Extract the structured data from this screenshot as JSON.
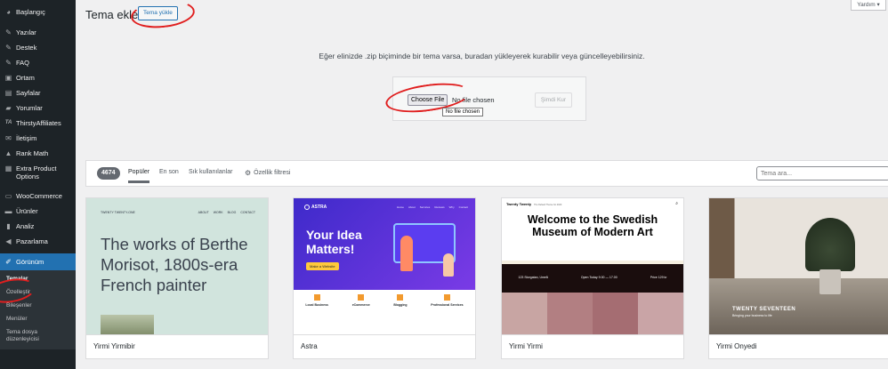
{
  "sidebar": {
    "items": [
      {
        "label": "Başlangıç",
        "icon": "dashboard-icon"
      },
      {
        "label": "Yazılar",
        "icon": "pin-icon"
      },
      {
        "label": "Destek",
        "icon": "pin-icon"
      },
      {
        "label": "FAQ",
        "icon": "pin-icon"
      },
      {
        "label": "Ortam",
        "icon": "media-icon"
      },
      {
        "label": "Sayfalar",
        "icon": "page-icon"
      },
      {
        "label": "Yorumlar",
        "icon": "comment-icon"
      },
      {
        "label": "ThirstyAffiliates",
        "icon": "ta-icon"
      },
      {
        "label": "İletişim",
        "icon": "mail-icon"
      },
      {
        "label": "Rank Math",
        "icon": "chart-icon"
      },
      {
        "label": "Extra Product Options",
        "icon": "grid-icon"
      },
      {
        "label": "WooCommerce",
        "icon": "woo-icon"
      },
      {
        "label": "Ürünler",
        "icon": "box-icon"
      },
      {
        "label": "Analiz",
        "icon": "bar-chart-icon"
      },
      {
        "label": "Pazarlama",
        "icon": "megaphone-icon"
      },
      {
        "label": "Görünüm",
        "icon": "brush-icon"
      }
    ],
    "submenu": [
      "Temalar",
      "Özelleştir",
      "Bileşenler",
      "Menüler",
      "Tema dosya düzenleyicisi"
    ]
  },
  "header": {
    "title": "Tema ekle",
    "upload_button": "Tema yükle",
    "help": "Yardım ▾"
  },
  "upload": {
    "description": "Eğer elinizde .zip biçiminde bir tema varsa, buradan yükleyerek kurabilir veya güncelleyebilirsiniz.",
    "choose_file": "Choose File",
    "no_file": "No file chosen",
    "install": "Şimdi Kur",
    "tooltip": "No file chosen"
  },
  "filter": {
    "count": "4674",
    "tabs": [
      "Popüler",
      "En son",
      "Sık kullanılanlar"
    ],
    "feature_filter": "Özellik filtresi",
    "search_placeholder": "Tema ara..."
  },
  "themes": [
    {
      "name": "Yirmi Yirmibir",
      "shot": {
        "brand": "TWENTY TWENTY-ONE",
        "nav": [
          "ABOUT",
          "WORK",
          "BLOG",
          "CONTACT"
        ],
        "headline": "The works of Berthe Morisot, 1800s-era French painter",
        "bg": "#d1e4dd"
      }
    },
    {
      "name": "Astra",
      "shot": {
        "brand": "ASTRA",
        "nav": [
          "Home",
          "About",
          "Services",
          "Reviews",
          "Why",
          "Contact"
        ],
        "headline": "Your Idea Matters!",
        "cta": "Make a Website",
        "features": [
          "Local Business",
          "eCommerce",
          "Blogging",
          "Professional Services"
        ]
      }
    },
    {
      "name": "Yirmi Yirmi",
      "shot": {
        "brand": "Twenty Twenty",
        "tagline": "The Default Theme for 2020",
        "headline": "Welcome to the Swedish Museum of Modern Art",
        "address": "123 Storgatan, Umeå",
        "hours": "Open Today 9.00 — 17.00",
        "price": "Price 129 kr"
      }
    },
    {
      "name": "Yirmi Onyedi",
      "shot": {
        "brand": "TWENTY SEVENTEEN",
        "tagline": "Bringing your business to life"
      }
    }
  ],
  "colors": {
    "sidebar": "#1d2327",
    "accent": "#2271b1",
    "annotation": "#e01e1e"
  }
}
